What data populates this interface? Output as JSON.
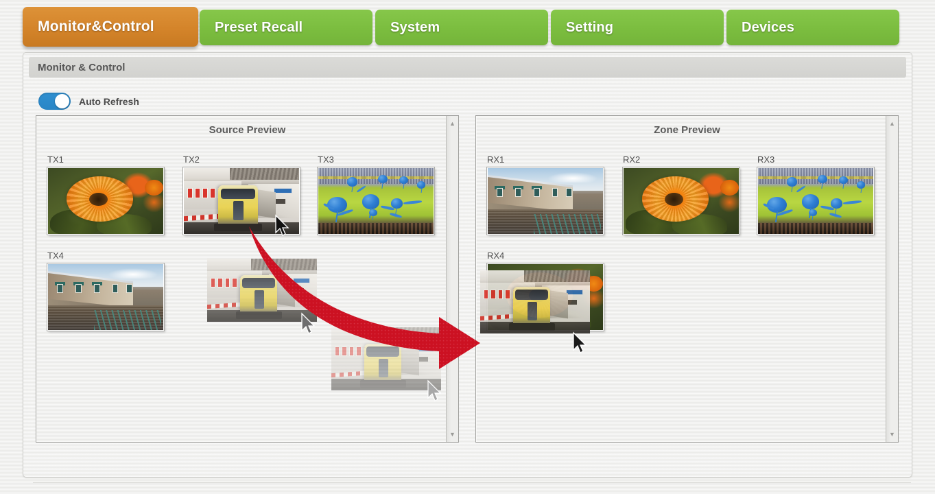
{
  "tabs": [
    {
      "label": "Monitor&Control",
      "active": true
    },
    {
      "label": "Preset Recall",
      "active": false
    },
    {
      "label": "System",
      "active": false
    },
    {
      "label": "Setting",
      "active": false
    },
    {
      "label": "Devices",
      "active": false
    }
  ],
  "card": {
    "header_title": "Monitor & Control"
  },
  "auto_refresh": {
    "label": "Auto Refresh",
    "enabled": true,
    "state_text": "On"
  },
  "source_panel": {
    "title": "Source Preview",
    "thumbs": [
      {
        "label": "TX1",
        "image": "flower"
      },
      {
        "label": "TX2",
        "image": "train"
      },
      {
        "label": "TX3",
        "image": "stadium"
      },
      {
        "label": "TX4",
        "image": "canal"
      }
    ]
  },
  "zone_panel": {
    "title": "Zone Preview",
    "thumbs": [
      {
        "label": "RX1",
        "image": "canal"
      },
      {
        "label": "RX2",
        "image": "flower"
      },
      {
        "label": "RX3",
        "image": "stadium"
      },
      {
        "label": "RX4",
        "image": "flower"
      }
    ]
  },
  "drag": {
    "source_label": "TX2",
    "target_label": "RX4",
    "dragged_image": "train",
    "ghost_count": 3,
    "arrow_color": "#cc1122"
  },
  "colors": {
    "tab_active": "#d4842a",
    "tab_inactive": "#7bbd3f",
    "toggle_on": "#2a86c6",
    "page_bg": "#eeeeec",
    "panel_border": "#9e9e9b",
    "header_text": "#565656"
  },
  "scrollbars": {
    "up_glyph": "▲",
    "down_glyph": "▼"
  }
}
